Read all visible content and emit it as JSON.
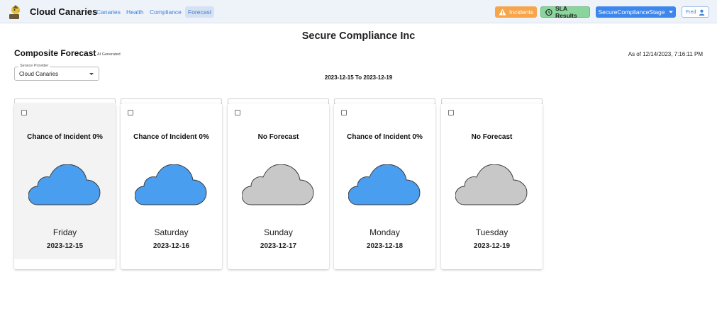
{
  "header": {
    "brand": "Cloud Canaries",
    "nav": [
      {
        "label": "Canaries"
      },
      {
        "label": "Health"
      },
      {
        "label": "Compliance"
      },
      {
        "label": "Forecast",
        "active": true
      }
    ],
    "incidents_label": "Incidents",
    "sla_label": "SLA Results",
    "environment_label": "SecureComplianceStage",
    "user_label": "Fred"
  },
  "page": {
    "company": "Secure Compliance Inc",
    "title": "Composite Forecast",
    "ai_tag": "AI Generated",
    "as_of": "As of 12/14/2023, 7:16:11 PM",
    "service_provider": {
      "label": "Service Provider",
      "value": "Cloud Canaries"
    },
    "date_range": "2023-12-15 To 2023-12-19"
  },
  "colors": {
    "forecast_cloud": "#4a9ef0",
    "no_forecast_cloud": "#c8c8c8",
    "incidents_button": "#f6a54a",
    "sla_button": "#8ad59b",
    "environment_button": "#3d86ec",
    "nav_link": "#3d7fd6"
  },
  "icons": {
    "logo": "canary-logo-icon",
    "incidents": "warning-icon",
    "sla": "history-clock-icon",
    "environment": "caret-down-icon",
    "user": "person-icon",
    "forecast": "cloud-icon"
  },
  "forecast": {
    "days": [
      {
        "heading": "Chance of Incident 0%",
        "day": "Friday",
        "date": "2023-12-15",
        "has_forecast": true,
        "highlighted": true
      },
      {
        "heading": "Chance of Incident 0%",
        "day": "Saturday",
        "date": "2023-12-16",
        "has_forecast": true,
        "highlighted": false
      },
      {
        "heading": "No Forecast",
        "day": "Sunday",
        "date": "2023-12-17",
        "has_forecast": false,
        "highlighted": false
      },
      {
        "heading": "Chance of Incident 0%",
        "day": "Monday",
        "date": "2023-12-18",
        "has_forecast": true,
        "highlighted": false
      },
      {
        "heading": "No Forecast",
        "day": "Tuesday",
        "date": "2023-12-19",
        "has_forecast": false,
        "highlighted": false
      }
    ]
  }
}
